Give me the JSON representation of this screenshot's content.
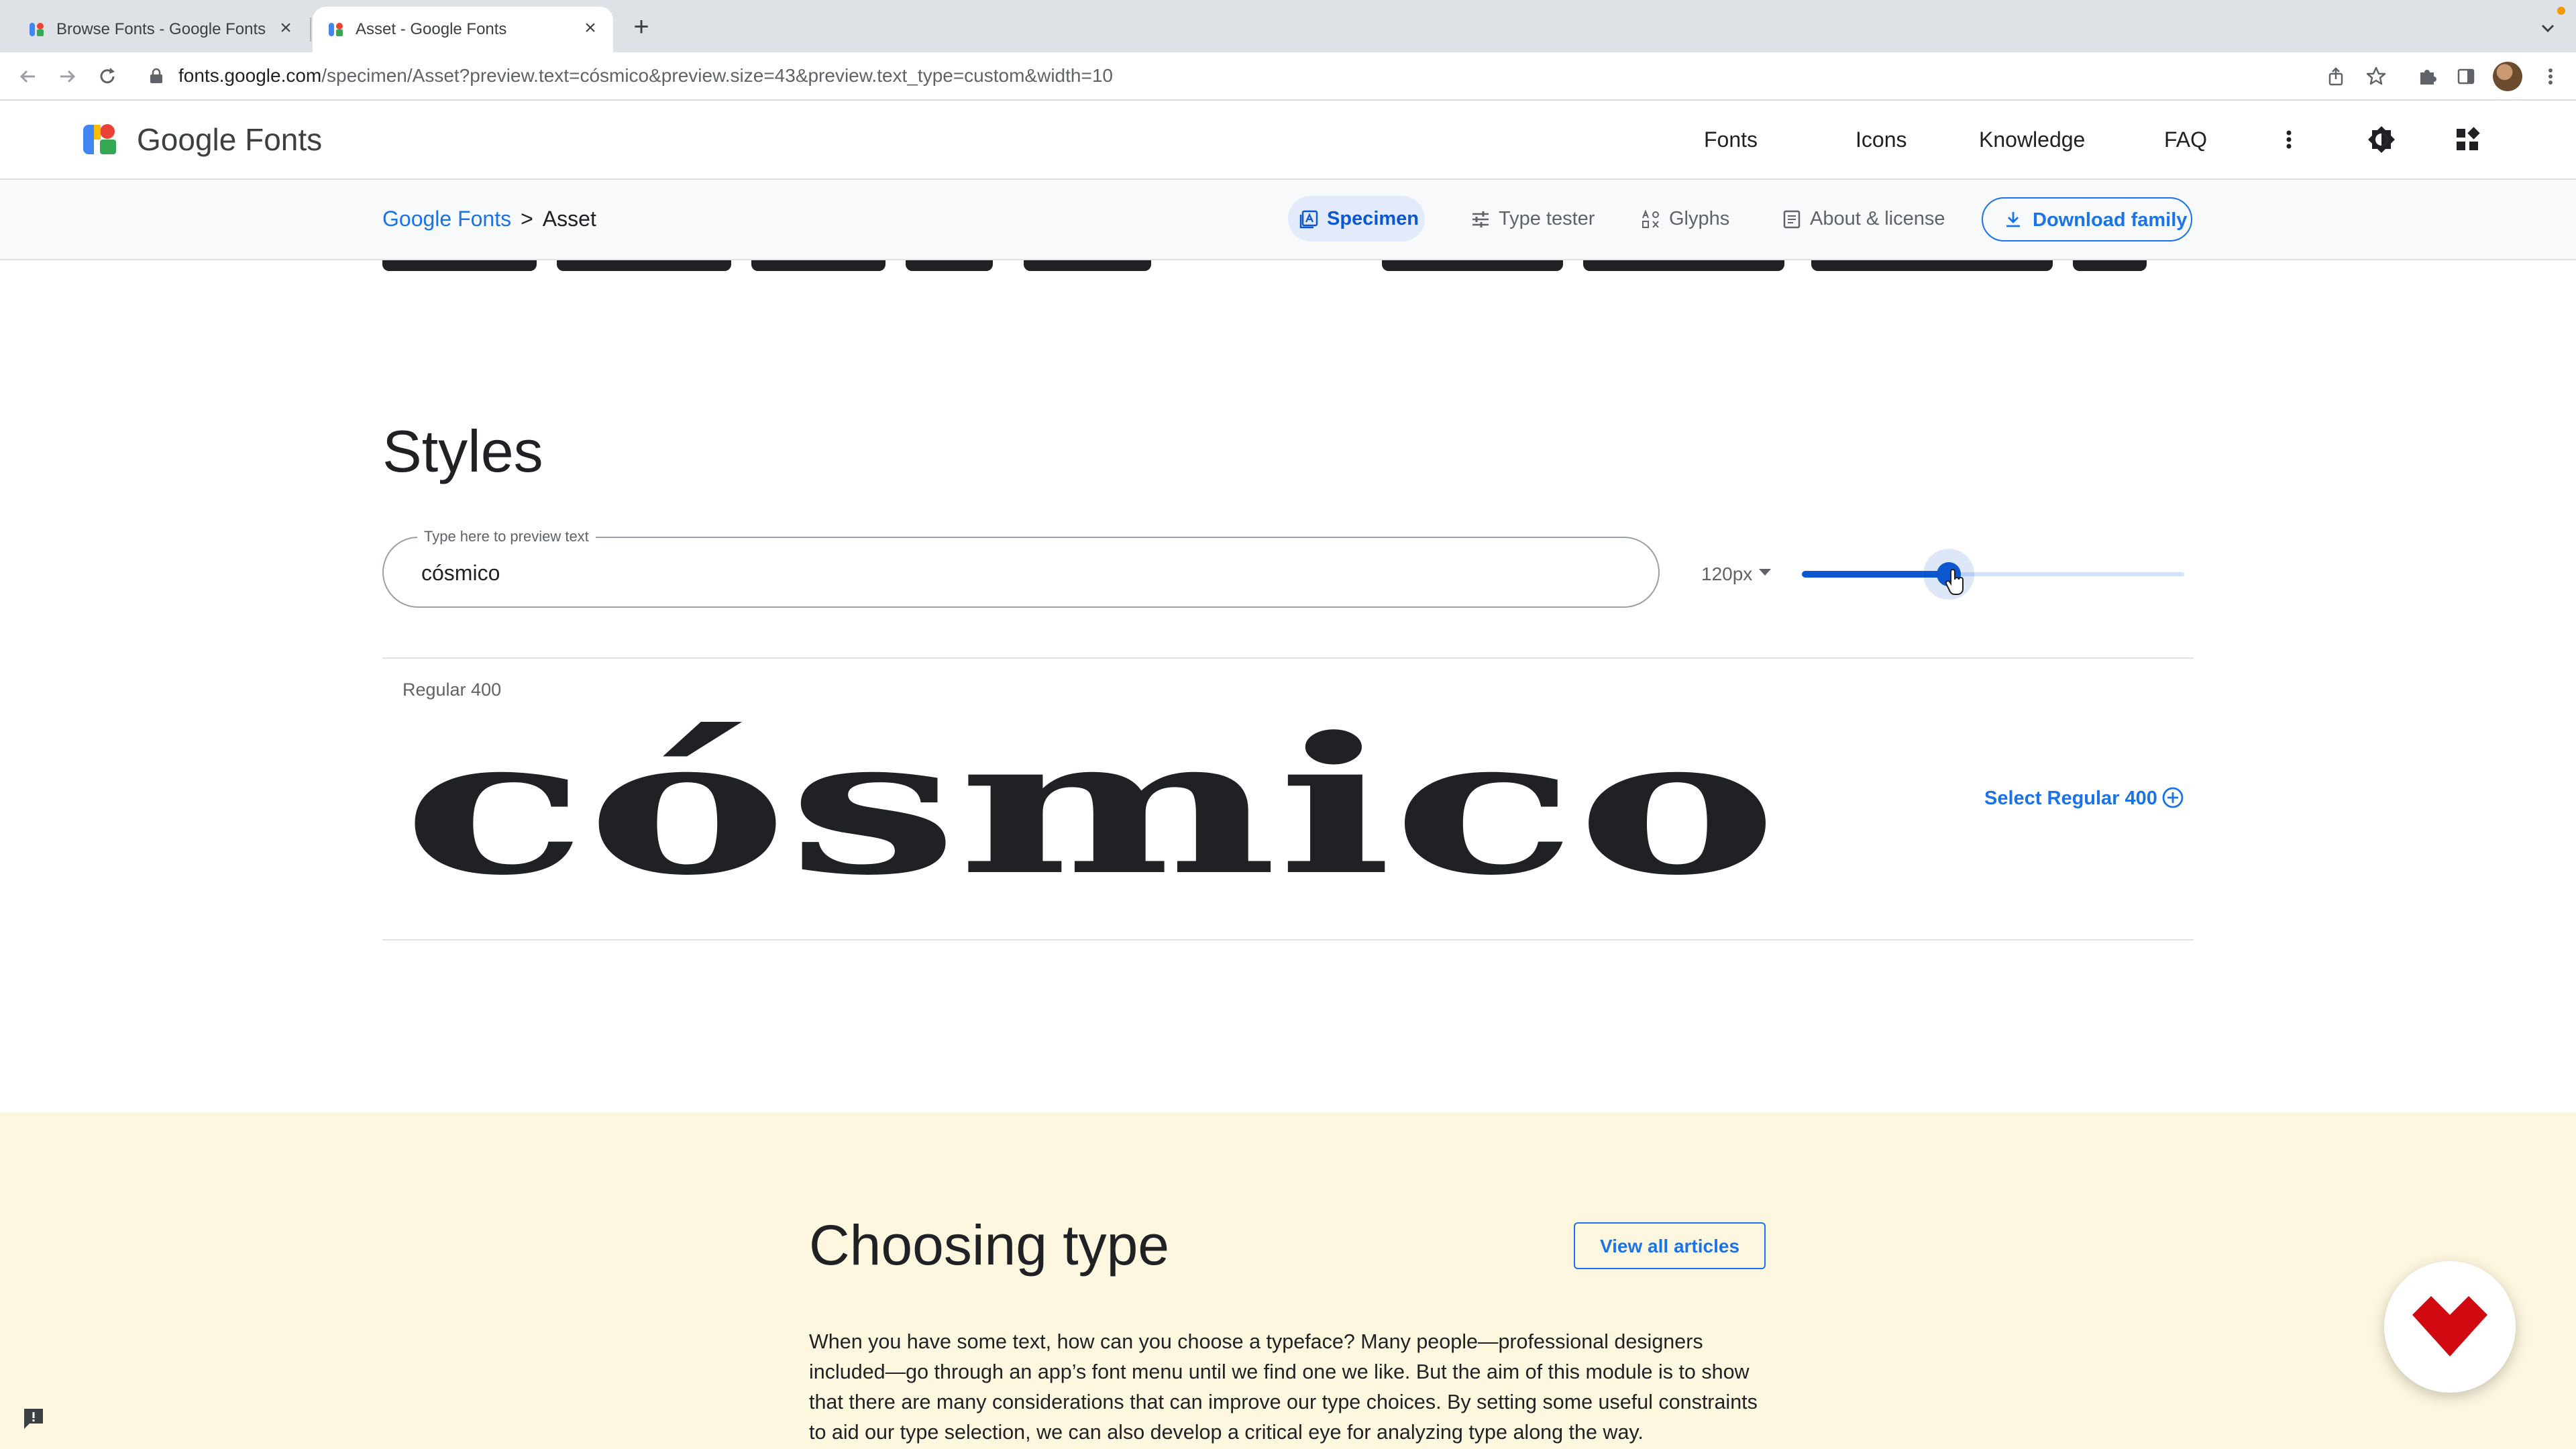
{
  "browser": {
    "tabs": [
      {
        "title": "Browse Fonts - Google Fonts",
        "active": false
      },
      {
        "title": "Asset - Google Fonts",
        "active": true
      }
    ],
    "url_host": "fonts.google.com",
    "url_path": "/specimen/Asset?preview.text=cósmico&preview.size=43&preview.text_type=custom&width=10"
  },
  "header": {
    "brand": "Google Fonts",
    "nav": [
      "Fonts",
      "Icons",
      "Knowledge",
      "FAQ"
    ]
  },
  "subnav": {
    "breadcrumb_root": "Google Fonts",
    "breadcrumb_sep": ">",
    "breadcrumb_current": "Asset",
    "tabs": [
      "Specimen",
      "Type tester",
      "Glyphs",
      "About & license"
    ],
    "download_label": "Download family"
  },
  "styles": {
    "heading": "Styles",
    "preview_legend": "Type here to preview text",
    "preview_text": "cósmico",
    "size_label": "120px",
    "slider_fraction": 0.385,
    "style_label": "Regular 400",
    "specimen_text": "cósmico",
    "select_label": "Select Regular 400"
  },
  "article": {
    "heading": "Choosing type",
    "view_all_label": "View all articles",
    "body": "When you have some text, how can you choose a typeface? Many people—professional designers included—go through an app’s font menu until we find one we like. But the aim of this module is to show that there are many considerations that can improve our type choices. By setting some useful constraints to aid our type selection, we can also develop a critical eye for analyzing type along the way."
  },
  "colors": {
    "accent": "#1a73e8",
    "article_band": "#fef7e0"
  }
}
